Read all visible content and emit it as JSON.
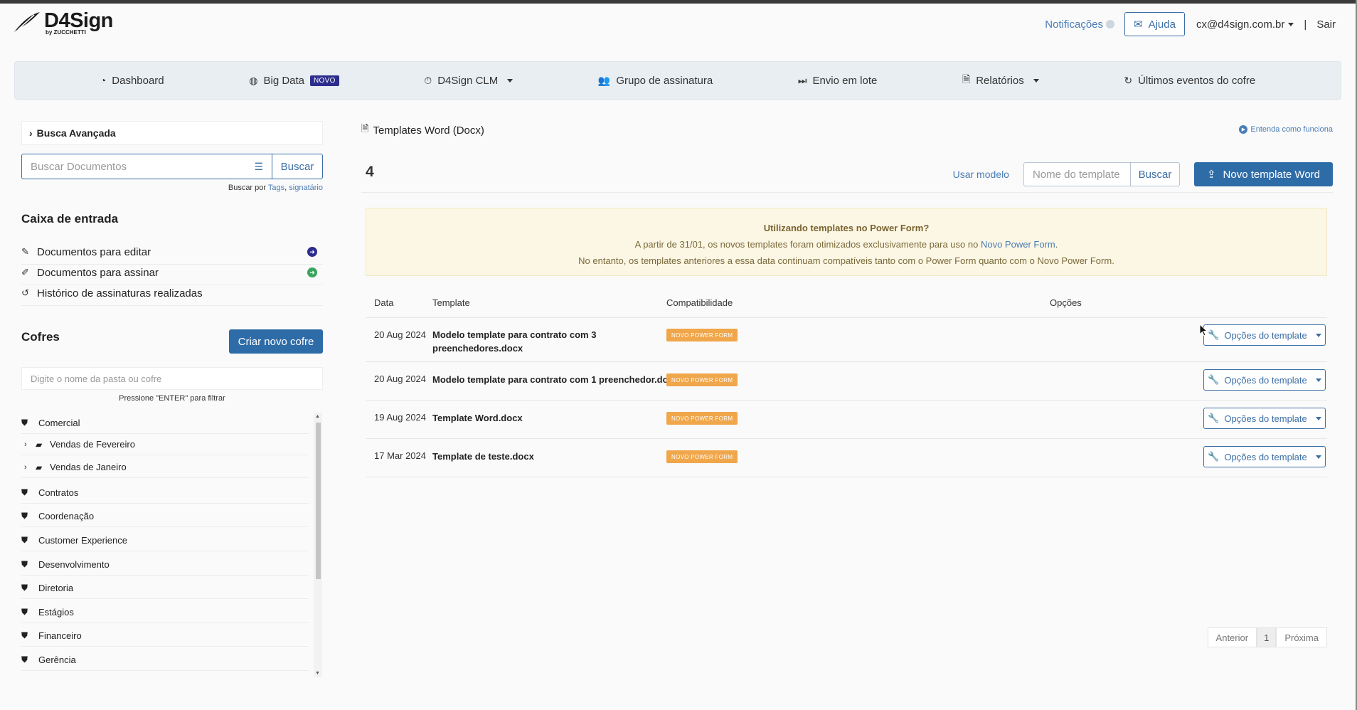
{
  "brand": {
    "name": "D4Sign",
    "sub": "by ZUCCHETTI"
  },
  "header": {
    "notifications": "Notificações",
    "help": "Ajuda",
    "user": "cx@d4sign.com.br",
    "separator": "|",
    "logout": "Sair"
  },
  "nav": {
    "dashboard": "Dashboard",
    "bigdata": "Big Data",
    "bigdata_badge": "NOVO",
    "clm": "D4Sign CLM",
    "grupo": "Grupo de assinatura",
    "lote": "Envio em lote",
    "relatorios": "Relatórios",
    "eventos": "Últimos eventos do cofre"
  },
  "sidebar": {
    "busca_avancada": "Busca Avançada",
    "search_placeholder": "Buscar Documentos",
    "search_button": "Buscar",
    "buscar_por": "Buscar por",
    "tags": "Tags",
    "comma": ",",
    "signatario": "signatário",
    "inbox_title": "Caixa de entrada",
    "inbox": [
      {
        "label": "Documentos para editar"
      },
      {
        "label": "Documentos para assinar"
      },
      {
        "label": "Histórico de assinaturas realizadas"
      }
    ],
    "cofres_title": "Cofres",
    "criar_cofre": "Criar novo cofre",
    "filter_placeholder": "Digite o nome da pasta ou cofre",
    "filter_hint": "Pressione \"ENTER\" para filtrar",
    "tree": [
      {
        "label": "Comercial"
      },
      {
        "label": "Vendas de Fevereiro"
      },
      {
        "label": "Vendas de Janeiro"
      },
      {
        "label": "Contratos"
      },
      {
        "label": "Coordenação"
      },
      {
        "label": "Customer Experience"
      },
      {
        "label": "Desenvolvimento"
      },
      {
        "label": "Diretoria"
      },
      {
        "label": "Estágios"
      },
      {
        "label": "Financeiro"
      },
      {
        "label": "Gerência"
      }
    ]
  },
  "main": {
    "title": "Templates Word (Docx)",
    "entenda": "Entenda como funciona",
    "count": "4",
    "usar_modelo": "Usar modelo",
    "template_placeholder": "Nome do template",
    "buscar": "Buscar",
    "novo_template": "Novo template Word",
    "alert": {
      "title": "Utilizando templates no Power Form?",
      "line1_a": "A partir de 31/01, os novos templates foram otimizados exclusivamente para uso no",
      "line1_link": "Novo Power Form",
      "line1_end": ".",
      "line2": "No entanto, os templates anteriores a essa data continuam compatíveis tanto com o Power Form quanto com o Novo Power Form."
    },
    "columns": {
      "data": "Data",
      "template": "Template",
      "compat": "Compatibilidade",
      "opcoes": "Opções"
    },
    "rows": [
      {
        "date": "20 Aug 2024",
        "name": "Modelo template para contrato com 3 preenchedores.docx",
        "badge": "NOVO POWER FORM",
        "options": "Opções do template"
      },
      {
        "date": "20 Aug 2024",
        "name": "Modelo template para contrato com 1 preenchedor.docx",
        "badge": "NOVO POWER FORM",
        "options": "Opções do template"
      },
      {
        "date": "19 Aug 2024",
        "name": "Template Word.docx",
        "badge": "NOVO POWER FORM",
        "options": "Opções do template"
      },
      {
        "date": "17 Mar 2024",
        "name": "Template de teste.docx",
        "badge": "NOVO POWER FORM",
        "options": "Opções do template"
      }
    ],
    "pager": {
      "prev": "Anterior",
      "current": "1",
      "next": "Próxima"
    }
  }
}
